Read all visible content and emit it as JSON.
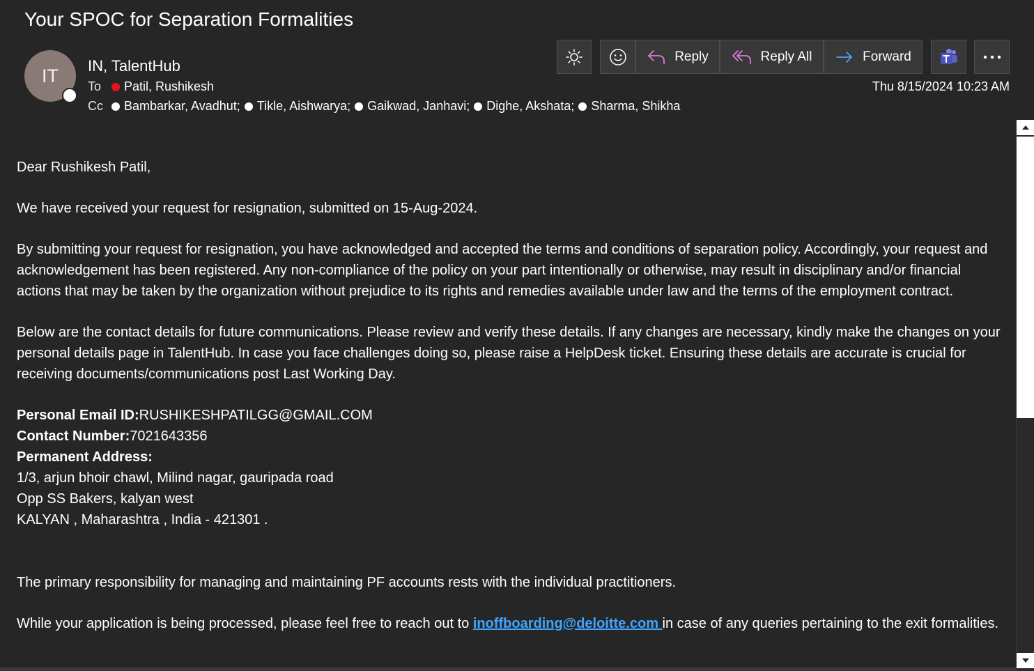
{
  "email": {
    "subject": "Your SPOC for Separation Formalities",
    "avatar_initials": "IT",
    "sender": "IN, TalentHub",
    "to_label": "To",
    "cc_label": "Cc",
    "to": [
      "Patil, Rushikesh"
    ],
    "cc": [
      "Bambarkar, Avadhut;",
      "Tikle, Aishwarya;",
      "Gaikwad, Janhavi;",
      "Dighe, Akshata;",
      "Sharma, Shikha"
    ],
    "date": "Thu 8/15/2024 10:23 AM"
  },
  "toolbar": {
    "theme_icon": "sun-icon",
    "emoji_icon": "smiley-icon",
    "reply_label": "Reply",
    "reply_all_label": "Reply All",
    "forward_label": "Forward",
    "teams_icon": "teams-icon",
    "more_icon": "more-icon"
  },
  "body": {
    "greeting": "Dear Rushikesh Patil,",
    "p1": "We have received your request for resignation, submitted on 15-Aug-2024.",
    "p2": "By submitting your request for resignation, you have acknowledged and accepted the terms and conditions of separation policy. Accordingly, your request and acknowledgement has been registered. Any non-compliance of the policy on your part intentionally or otherwise, may result in disciplinary and/or financial actions that may be taken by the organization without prejudice to its rights and remedies available under law and the terms of the employment contract.",
    "p3": "Below are the contact details for future communications. Please review and verify these details. If any changes are necessary, kindly make the changes on your personal details page in TalentHub. In case you face challenges doing so, please raise a HelpDesk ticket. Ensuring these details are accurate is crucial for receiving documents/communications post Last Working Day.",
    "email_label": "Personal Email ID:",
    "email_value": "RUSHIKESHPATILGG@GMAIL.COM",
    "contact_label": "Contact Number:",
    "contact_value": "7021643356",
    "address_label": "Permanent Address:",
    "address_line1": "1/3, arjun bhoir chawl, Milind nagar, gauripada road",
    "address_line2": "Opp SS Bakers, kalyan west",
    "address_line3": "KALYAN , Maharashtra , India - 421301 .",
    "p4": "The primary responsibility for managing and maintaining PF accounts rests with the individual practitioners.",
    "p5_before": "While your application is being processed, please feel free to reach out to ",
    "p5_link": "inoffboarding@deloitte.com ",
    "p5_after": "in case of any queries pertaining to the exit formalities."
  },
  "colors": {
    "background": "#262626",
    "link": "#3ea6ff",
    "reply_icon": "#d77fd8",
    "forward_icon": "#4aa3f0",
    "teams": "#7b83eb",
    "presence_red": "#e81123"
  }
}
